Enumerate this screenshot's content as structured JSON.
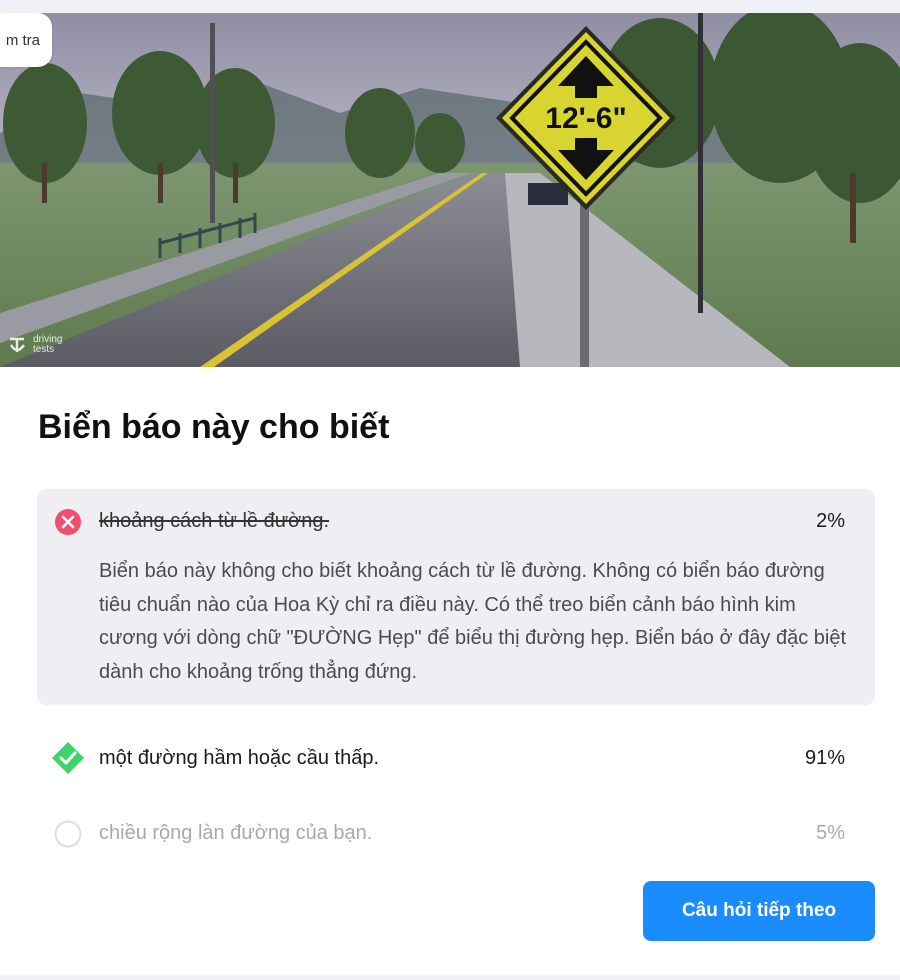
{
  "badge": {
    "label": "m tra"
  },
  "image": {
    "sign_text": "12'-6\"",
    "watermark": "driving tests"
  },
  "question": {
    "title": "Biển báo này cho biết"
  },
  "answers": [
    {
      "text": "khoảng cách từ lề đường.",
      "percent": "2%",
      "status": "incorrect",
      "explanation": "Biển báo này không cho biết khoảng cách từ lề đường. Không có biển báo đường tiêu chuẩn nào của Hoa Kỳ chỉ ra điều này. Có thể treo biển cảnh báo hình kim cương với dòng chữ \"ĐƯỜNG Hẹp\" để biểu thị đường hẹp. Biển báo ở đây đặc biệt dành cho khoảng trống thẳng đứng."
    },
    {
      "text": "một đường hầm hoặc cầu thấp.",
      "percent": "91%",
      "status": "correct"
    },
    {
      "text": "chiều rộng làn đường của bạn.",
      "percent": "5%",
      "status": "unselected"
    }
  ],
  "next_button": {
    "label": "Câu hỏi tiếp theo"
  },
  "colors": {
    "incorrect": "#f0506e",
    "correct": "#3fd36b",
    "button": "#1a8cff",
    "explanation_bg": "#efeff3"
  }
}
